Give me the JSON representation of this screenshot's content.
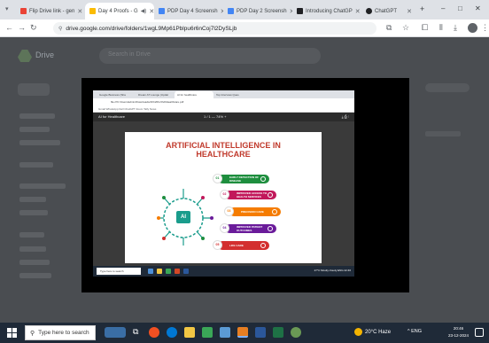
{
  "browser": {
    "tabs": [
      {
        "label": "Flip Drive link - gen",
        "color": "#ea4335"
      },
      {
        "label": "Day 4 Proofs - G",
        "color": "#fbbc04"
      },
      {
        "label": "PDP Day 4 Screensh",
        "color": "#4285f4"
      },
      {
        "label": "PDP Day 2 Screensh",
        "color": "#4285f4"
      },
      {
        "label": "Introducing ChatGP",
        "color": "#202124"
      },
      {
        "label": "ChatGPT",
        "color": "#202124"
      }
    ],
    "new_tab": "+",
    "window_controls": {
      "minimize": "–",
      "maximize": "□",
      "close": "✕"
    },
    "url": "drive.google.com/drive/folders/1wgL9Mp61Pblpu6r6nCoj7l2DySLjb"
  },
  "drive": {
    "title": "Drive",
    "search_placeholder": "Search in Drive"
  },
  "preview": {
    "inner_tabs": [
      "Google Business (Sha",
      "Dream AT Lounge (Updat",
      "AI for healthcare",
      "Top Interview Ques"
    ],
    "inner_url": "file:///C:/Users/admin/Downloads/AI%20for%20Healthcare.pdf",
    "inner_bookmarks": "Gmail   WhatsApp   Dell   ChatGPT   Zoom   Tally   News",
    "viewer_title": "AI for Healthcare",
    "viewer_zoom": "1 / 1   —  74%  +",
    "slide": {
      "title_line1": "ARTIFICIAL INTELLIGENCE IN",
      "title_line2": "HEALTHCARE",
      "center_label": "AI",
      "items": [
        {
          "number": "01",
          "label": "EARLY DETECTION OF DISEASE",
          "color": "#1e8e3e"
        },
        {
          "number": "02",
          "label": "IMPROVED ACCESS TO HEALTH SERVICES",
          "color": "#c2185b"
        },
        {
          "number": "03",
          "label": "PRECISION CARE",
          "color": "#f57c00"
        },
        {
          "number": "04",
          "label": "IMPROVED PATIENT OUTCOMES",
          "color": "#6a1b9a"
        },
        {
          "number": "05",
          "label": "LIFE CARE",
          "color": "#d32f2f"
        }
      ]
    },
    "inner_taskbar": {
      "search": "Type here to search",
      "tray": "27°C Mostly cloudy  ENG  22:46"
    }
  },
  "taskbar": {
    "search_placeholder": "Type here to search",
    "weather": "20°C Haze",
    "tray": "^  ENG",
    "time": "20:46",
    "date": "23-12-2024"
  }
}
